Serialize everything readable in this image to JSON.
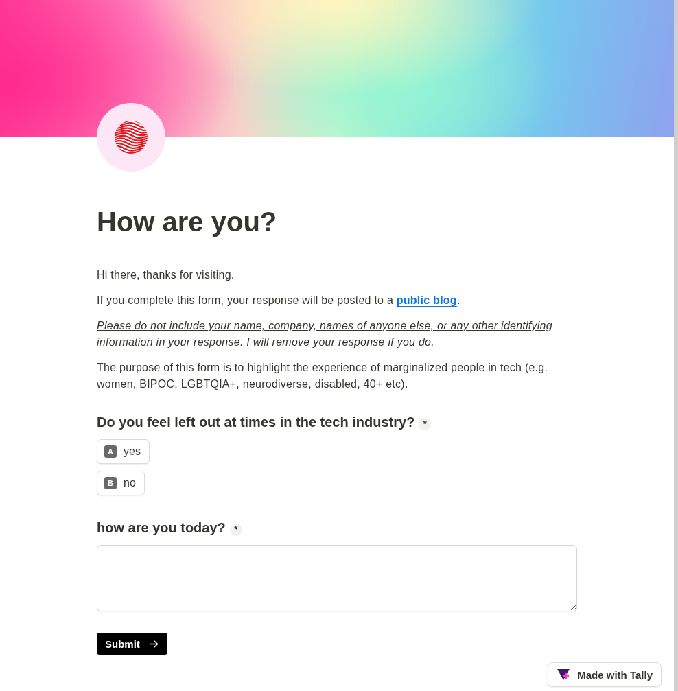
{
  "form": {
    "title": "How are you?"
  },
  "paragraphs": [
    {
      "kind": "plain",
      "text": "Hi there, thanks for visiting."
    },
    {
      "kind": "link",
      "text": "If you complete this form, your response will be posted to a ",
      "link": "public blog",
      "after": "."
    },
    {
      "kind": "notice",
      "text": "Please do not include your name, company, names of anyone else, or any other identifying information in your response. I will remove your response if you do."
    },
    {
      "kind": "plain",
      "text": "The purpose of this form is to highlight the experience of marginalized people in tech (e.g. women, BIPOC, LGBTQIA+, neurodiverse, disabled, 40+ etc)."
    }
  ],
  "questions": [
    {
      "kind": "choice",
      "label": "Do you feel left out at times in the tech industry?",
      "required_mark": "*",
      "options": [
        {
          "key": "A",
          "label": "yes",
          "selected": false
        },
        {
          "key": "B",
          "label": "no",
          "selected": false
        }
      ]
    },
    {
      "kind": "long_text",
      "label": "how are you today?",
      "required_mark": "*"
    }
  ],
  "submit": {
    "label": "Submit"
  },
  "badge": {
    "label": "Made with Tally"
  }
}
